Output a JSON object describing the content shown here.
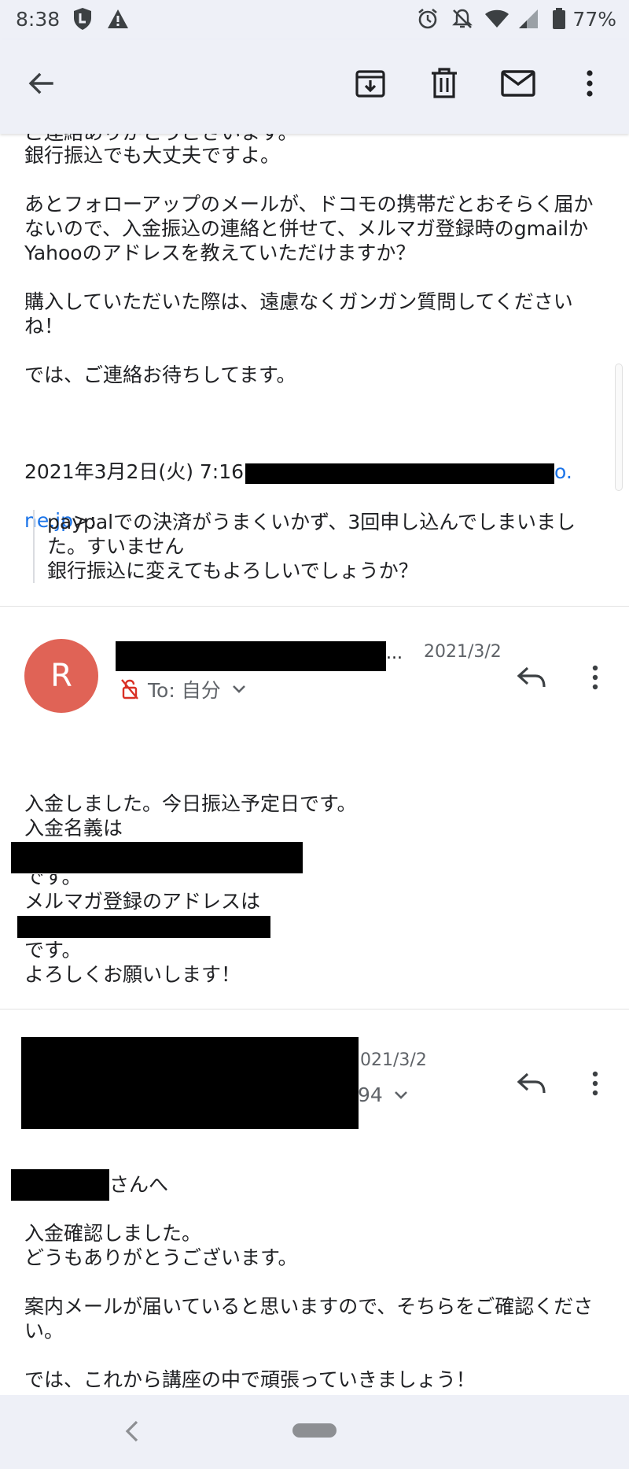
{
  "status_bar": {
    "time": "8:38",
    "battery": "77%"
  },
  "toolbar": {
    "back_icon": "arrow-left-icon",
    "archive_icon": "archive-icon",
    "delete_icon": "trash-icon",
    "mark_unread_icon": "mail-icon",
    "more_icon": "more-vert-icon"
  },
  "message1": {
    "line_top": "ご連絡ありがとうございます。",
    "body": "銀行振込でも大丈夫ですよ。\n\nあとフォローアップのメールが、ドコモの携帯だとおそらく届かないので、入金振込の連絡と併せて、メルマガ登録時のgmailかYahooのアドレスを教えていただけますか？\n\n購入していただいた際は、遠慮なくガンガン質問してくださいね！\n\nでは、ご連絡お待ちしてます。",
    "quote_header": "2021年3月2日(火) 7:16",
    "quote_email_tail_1": "o.",
    "quote_email_tail_2": "ne.jp",
    "quote_suffix": ">:",
    "quote_body": "paypalでの決済がうまくいかず、3回申し込んでしまいました。すいません\n銀行振込に変えてもよろしいでしょうか？"
  },
  "message2": {
    "avatar_letter": "R",
    "ellipsis": "...",
    "date": "2021/3/2",
    "to_label": "To: 自分",
    "body_1": "入金しました。今日振込予定日です。\n入金名義は",
    "body_2": "です。",
    "body_3": "メルマガ登録のアドレスは",
    "body_4": "です。\nよろしくお願いします！"
  },
  "message3": {
    "date": "021/3/2",
    "to_tail": "94",
    "salutation": "さんへ",
    "body": "入金確認しました。\nどうもありがとうございます。\n\n案内メールが届いていると思いますので、そちらをご確認ください。\n\nでは、これから講座の中で頑張っていきましょう！"
  },
  "colors": {
    "accent_link": "#1a73e8",
    "avatar_bg": "#e06356",
    "bar_bg": "#eef0f7"
  }
}
